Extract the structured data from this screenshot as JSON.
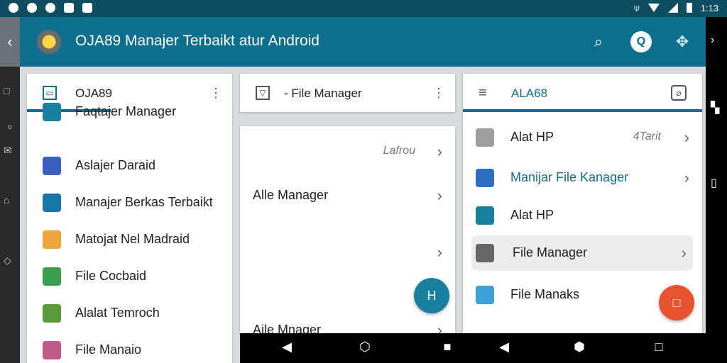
{
  "status_bar": {
    "time": "1:13"
  },
  "app_bar": {
    "title": "OJA89 Manajer Terbaikt atur Android"
  },
  "left_panel": {
    "header": "OJA89",
    "items": [
      {
        "label": "Faqtajer Manager",
        "color": "#1a7fa0"
      },
      {
        "label": "Aslajer Daraid",
        "color": "#3b5fc0"
      },
      {
        "label": "Manajer Berkas Terbaikt",
        "color": "#1778a8"
      },
      {
        "label": "Matojat Nel Madraid",
        "color": "#f0a53a"
      },
      {
        "label": "File Cocbaid",
        "color": "#3aa050"
      },
      {
        "label": "Alalat Temroch",
        "color": "#5a9a3a"
      },
      {
        "label": "File Manaio",
        "color": "#c05a8a"
      }
    ]
  },
  "middle_panel": {
    "header": "- File Manager",
    "rows": [
      {
        "label": "",
        "sub": "Lafrou"
      },
      {
        "label": "Alle Manager",
        "sub": ""
      },
      {
        "label": "",
        "sub": ""
      },
      {
        "label": "Aile Mnager",
        "sub": ""
      }
    ],
    "fab_label": "H"
  },
  "right_panel": {
    "header": "ALA68",
    "rows": [
      {
        "label": "Alat HP",
        "sub": "4Tarit",
        "color": "#9e9e9e"
      },
      {
        "label": "Manijar File Kanager",
        "sub": "",
        "color": "#2f6fbf"
      },
      {
        "label": "Alat HP",
        "sub": "",
        "color": "#1a7fa0"
      },
      {
        "label": "File Manager",
        "sub": "",
        "color": "#666666"
      },
      {
        "label": "File Manaks",
        "sub": "",
        "color": "#3fa0d8"
      }
    ],
    "fab_label": "□"
  }
}
